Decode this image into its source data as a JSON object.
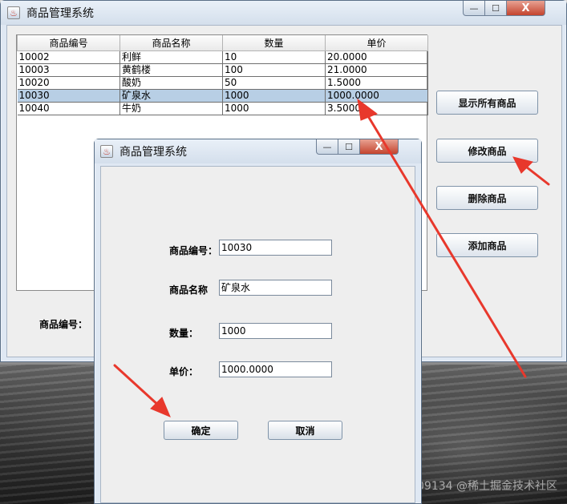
{
  "main_window": {
    "title": "商品管理系统",
    "controls": {
      "minimize": "—",
      "maximize": "☐",
      "close": "X"
    },
    "table": {
      "columns": [
        "商品编号",
        "商品名称",
        "数量",
        "单价"
      ],
      "rows": [
        [
          "10002",
          "利鲜",
          "10",
          "20.0000"
        ],
        [
          "10003",
          "黄鹤楼",
          "100",
          "21.0000"
        ],
        [
          "10020",
          "酸奶",
          "50",
          "1.5000"
        ],
        [
          "10030",
          "矿泉水",
          "1000",
          "1000.0000"
        ],
        [
          "10040",
          "牛奶",
          "1000",
          "3.5000"
        ]
      ],
      "selected_row_index": 3
    },
    "buttons": {
      "show_all": "显示所有商品",
      "modify": "修改商品",
      "delete": "删除商品",
      "add": "添加商品"
    },
    "bottom_label": "商品编号："
  },
  "dialog": {
    "title": "商品管理系统",
    "controls": {
      "minimize": "—",
      "maximize": "☐",
      "close": "X"
    },
    "fields": {
      "id_label": "商品编号：",
      "id_value": "10030",
      "name_label": "商品名称",
      "name_value": "矿泉水",
      "qty_label": "数量：",
      "qty_value": "1000",
      "price_label": "单价：",
      "price_value": "1000.0000"
    },
    "buttons": {
      "ok": "确定",
      "cancel": "取消"
    }
  },
  "watermark": "https://blog.csdn.net/weixin_39709134 @稀土掘金技术社区",
  "colors": {
    "selection": "#b8cfe5",
    "annotation_arrow": "#e8382c",
    "close_button": "#c4442e"
  },
  "icons": {
    "app": "java-cup-icon"
  }
}
